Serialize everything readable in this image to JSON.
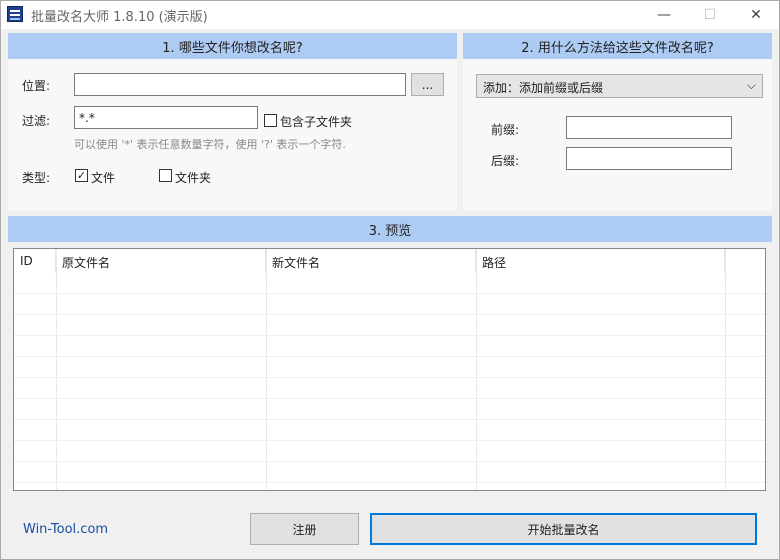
{
  "window": {
    "title": "批量改名大师 1.8.10 (演示版)",
    "minimize": "—",
    "maximize": "☐",
    "close": "✕"
  },
  "section1": {
    "header": "1. 哪些文件你想改名呢?",
    "location_label": "位置:",
    "location_value": "",
    "browse_button": "...",
    "filter_label": "过滤:",
    "filter_value": "*.*",
    "include_subfolders_label": "包含子文件夹",
    "include_subfolders_checked": false,
    "hint": "可以使用 '*' 表示任意数量字符，使用 '?' 表示一个字符.",
    "type_label": "类型:",
    "type_file_label": "文件",
    "type_file_checked": true,
    "type_folder_label": "文件夹",
    "type_folder_checked": false
  },
  "section2": {
    "header": "2. 用什么方法给这些文件改名呢?",
    "method_selected": "添加：添加前缀或后缀",
    "prefix_label": "前缀:",
    "prefix_value": "",
    "suffix_label": "后缀:",
    "suffix_value": ""
  },
  "section3": {
    "header": "3. 预览",
    "columns": [
      "ID",
      "原文件名",
      "新文件名",
      "路径"
    ],
    "rows": []
  },
  "footer": {
    "link": "Win-Tool.com",
    "register_button": "注册",
    "start_button": "开始批量改名"
  },
  "colors": {
    "section_header_bg": "#aecbf4",
    "link": "#1a4fa3",
    "primary_button_border": "#0078d7"
  }
}
